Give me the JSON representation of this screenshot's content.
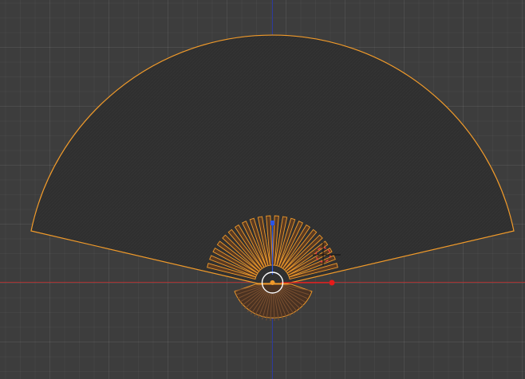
{
  "viewport": {
    "mode": "3d-viewport-top-orthographic",
    "background_color": "#3d3d3d",
    "grid_visible": true
  },
  "axes": {
    "x_axis_color": "#b82a2a",
    "y_axis_color": "#2c3a9c"
  },
  "selection": {
    "outline_color": "#f09a2a",
    "active_object": "fan"
  },
  "fan": {
    "paper_color": "#2f2f2f",
    "rib_count": 22,
    "rib_fill_color": "#5a3a22"
  },
  "gizmos": {
    "origin_ring_color": "#ffffff",
    "origin_dot_color": "#f09a2a",
    "x_handle_color": "#e81a1a",
    "z_handle_color": "#2a56e8",
    "cursor_color": "#d8d8d8"
  }
}
